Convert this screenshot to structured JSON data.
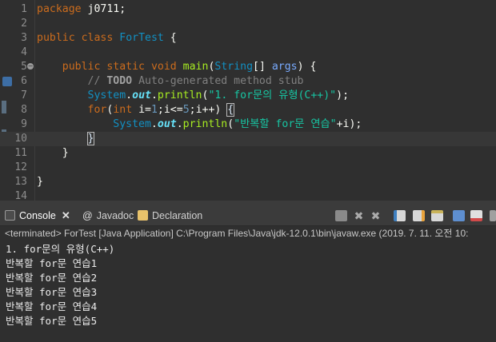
{
  "editor": {
    "lines": [
      {
        "n": "1",
        "segments": [
          {
            "t": "package",
            "c": "kw"
          },
          {
            "t": " j0711;",
            "c": "plain"
          }
        ]
      },
      {
        "n": "2",
        "segments": []
      },
      {
        "n": "3",
        "segments": [
          {
            "t": "public",
            "c": "kw"
          },
          {
            "t": " ",
            "c": "plain"
          },
          {
            "t": "class",
            "c": "kw"
          },
          {
            "t": " ",
            "c": "plain"
          },
          {
            "t": "ForTest",
            "c": "cls"
          },
          {
            "t": " {",
            "c": "plain"
          }
        ]
      },
      {
        "n": "4",
        "segments": []
      },
      {
        "n": "5",
        "segments": [
          {
            "t": "    ",
            "c": "plain"
          },
          {
            "t": "public",
            "c": "kw"
          },
          {
            "t": " ",
            "c": "plain"
          },
          {
            "t": "static",
            "c": "kw"
          },
          {
            "t": " ",
            "c": "plain"
          },
          {
            "t": "void",
            "c": "kw"
          },
          {
            "t": " ",
            "c": "plain"
          },
          {
            "t": "main",
            "c": "fn"
          },
          {
            "t": "(",
            "c": "plain"
          },
          {
            "t": "String",
            "c": "cls"
          },
          {
            "t": "[] ",
            "c": "plain"
          },
          {
            "t": "args",
            "c": "param"
          },
          {
            "t": ") {",
            "c": "plain"
          }
        ]
      },
      {
        "n": "6",
        "segments": [
          {
            "t": "        ",
            "c": "plain"
          },
          {
            "t": "// ",
            "c": "cmt"
          },
          {
            "t": "TODO",
            "c": "todo"
          },
          {
            "t": " Auto-generated method stub",
            "c": "cmt"
          }
        ]
      },
      {
        "n": "7",
        "segments": [
          {
            "t": "        ",
            "c": "plain"
          },
          {
            "t": "System",
            "c": "cls"
          },
          {
            "t": ".",
            "c": "plain"
          },
          {
            "t": "out",
            "c": "fld"
          },
          {
            "t": ".",
            "c": "plain"
          },
          {
            "t": "println",
            "c": "fn"
          },
          {
            "t": "(",
            "c": "plain"
          },
          {
            "t": "\"1. for문의 유형(C++)\"",
            "c": "str"
          },
          {
            "t": ");",
            "c": "plain"
          }
        ]
      },
      {
        "n": "8",
        "segments": [
          {
            "t": "        ",
            "c": "plain"
          },
          {
            "t": "for",
            "c": "kw"
          },
          {
            "t": "(",
            "c": "plain"
          },
          {
            "t": "int",
            "c": "kw"
          },
          {
            "t": " i=",
            "c": "plain"
          },
          {
            "t": "1",
            "c": "num"
          },
          {
            "t": ";i<=",
            "c": "plain"
          },
          {
            "t": "5",
            "c": "num"
          },
          {
            "t": ";i++) ",
            "c": "plain"
          },
          {
            "t": "{",
            "c": "brkt"
          }
        ]
      },
      {
        "n": "9",
        "segments": [
          {
            "t": "            ",
            "c": "plain"
          },
          {
            "t": "System",
            "c": "cls"
          },
          {
            "t": ".",
            "c": "plain"
          },
          {
            "t": "out",
            "c": "fld"
          },
          {
            "t": ".",
            "c": "plain"
          },
          {
            "t": "println",
            "c": "fn"
          },
          {
            "t": "(",
            "c": "plain"
          },
          {
            "t": "\"반복할 for문 연습\"",
            "c": "str"
          },
          {
            "t": "+i);",
            "c": "plain"
          }
        ]
      },
      {
        "n": "10",
        "segments": [
          {
            "t": "        ",
            "c": "plain"
          },
          {
            "t": "}",
            "c": "brkt"
          }
        ]
      },
      {
        "n": "11",
        "segments": [
          {
            "t": "    }",
            "c": "plain"
          }
        ]
      },
      {
        "n": "12",
        "segments": []
      },
      {
        "n": "13",
        "segments": [
          {
            "t": "}",
            "c": "plain"
          }
        ]
      },
      {
        "n": "14",
        "segments": []
      }
    ]
  },
  "console": {
    "tabs": [
      {
        "label": "Console",
        "icon": "console-icon",
        "active": true
      },
      {
        "label": "Javadoc",
        "icon": "javadoc-icon",
        "active": false
      },
      {
        "label": "Declaration",
        "icon": "declaration-icon",
        "active": false
      }
    ],
    "toolbar_icons": [
      "terminate-icon",
      "remove-launch-icon",
      "remove-all-terminated-icon",
      "scroll-lock-icon",
      "word-wrap-icon",
      "pin-console-icon",
      "display-selected-console-icon",
      "open-console-icon",
      "new-console-icon"
    ],
    "status": "<terminated> ForTest [Java Application] C:\\Program Files\\Java\\jdk-12.0.1\\bin\\javaw.exe (2019. 7. 11. 오전 10:",
    "output": [
      "1. for문의 유형(C++)",
      "반복할 for문 연습1",
      "반복할 for문 연습2",
      "반복할 for문 연습3",
      "반복할 for문 연습4",
      "반복할 for문 연습5"
    ]
  },
  "colors": {
    "editor_bg": "#2f2f2f",
    "keyword": "#cc6c1d",
    "class": "#1290c3",
    "method": "#a7ec21",
    "string": "#17c6a3",
    "field": "#66e1f8",
    "comment": "#808080"
  }
}
